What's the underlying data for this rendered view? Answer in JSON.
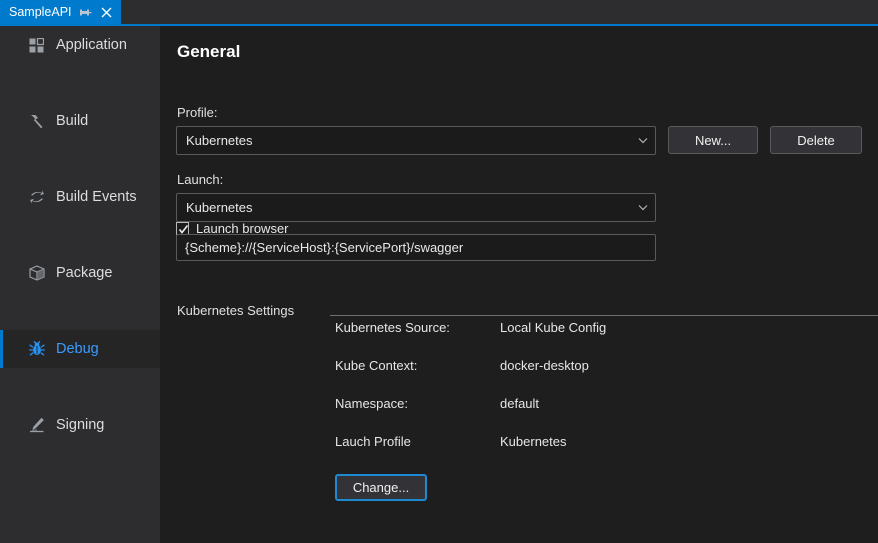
{
  "tab": {
    "title": "SampleAPI",
    "pin_icon": "pin-icon",
    "close_icon": "close-icon"
  },
  "sidebar": {
    "items": [
      {
        "label": "Application",
        "icon": "grid-icon",
        "selected": false
      },
      {
        "label": "Build",
        "icon": "hammer-icon",
        "selected": false
      },
      {
        "label": "Build Events",
        "icon": "arrows-icon",
        "selected": false
      },
      {
        "label": "Package",
        "icon": "box-icon",
        "selected": false
      },
      {
        "label": "Debug",
        "icon": "bug-icon",
        "selected": true
      },
      {
        "label": "Signing",
        "icon": "pen-icon",
        "selected": false
      }
    ]
  },
  "main": {
    "title": "General",
    "profile_label": "Profile:",
    "profile_value": "Kubernetes",
    "new_button": "New...",
    "delete_button": "Delete",
    "launch_label": "Launch:",
    "launch_value": "Kubernetes",
    "launch_browser_label": "Launch browser",
    "launch_browser_checked": true,
    "launch_url": "{Scheme}://{ServiceHost}:{ServicePort}/swagger",
    "section_header": "Kubernetes Settings",
    "settings": [
      {
        "label": "Kubernetes Source:",
        "value": "Local Kube Config"
      },
      {
        "label": "Kube Context:",
        "value": "docker-desktop"
      },
      {
        "label": "Namespace:",
        "value": "default"
      },
      {
        "label": "Lauch Profile",
        "value": "Kubernetes"
      }
    ],
    "change_button": "Change..."
  },
  "colors": {
    "accent": "#007acc",
    "tab_active_bg": "#007acc",
    "sidebar_bg": "#2d2d30",
    "content_bg": "#1e1e1e",
    "selected_text": "#3b9bff"
  }
}
